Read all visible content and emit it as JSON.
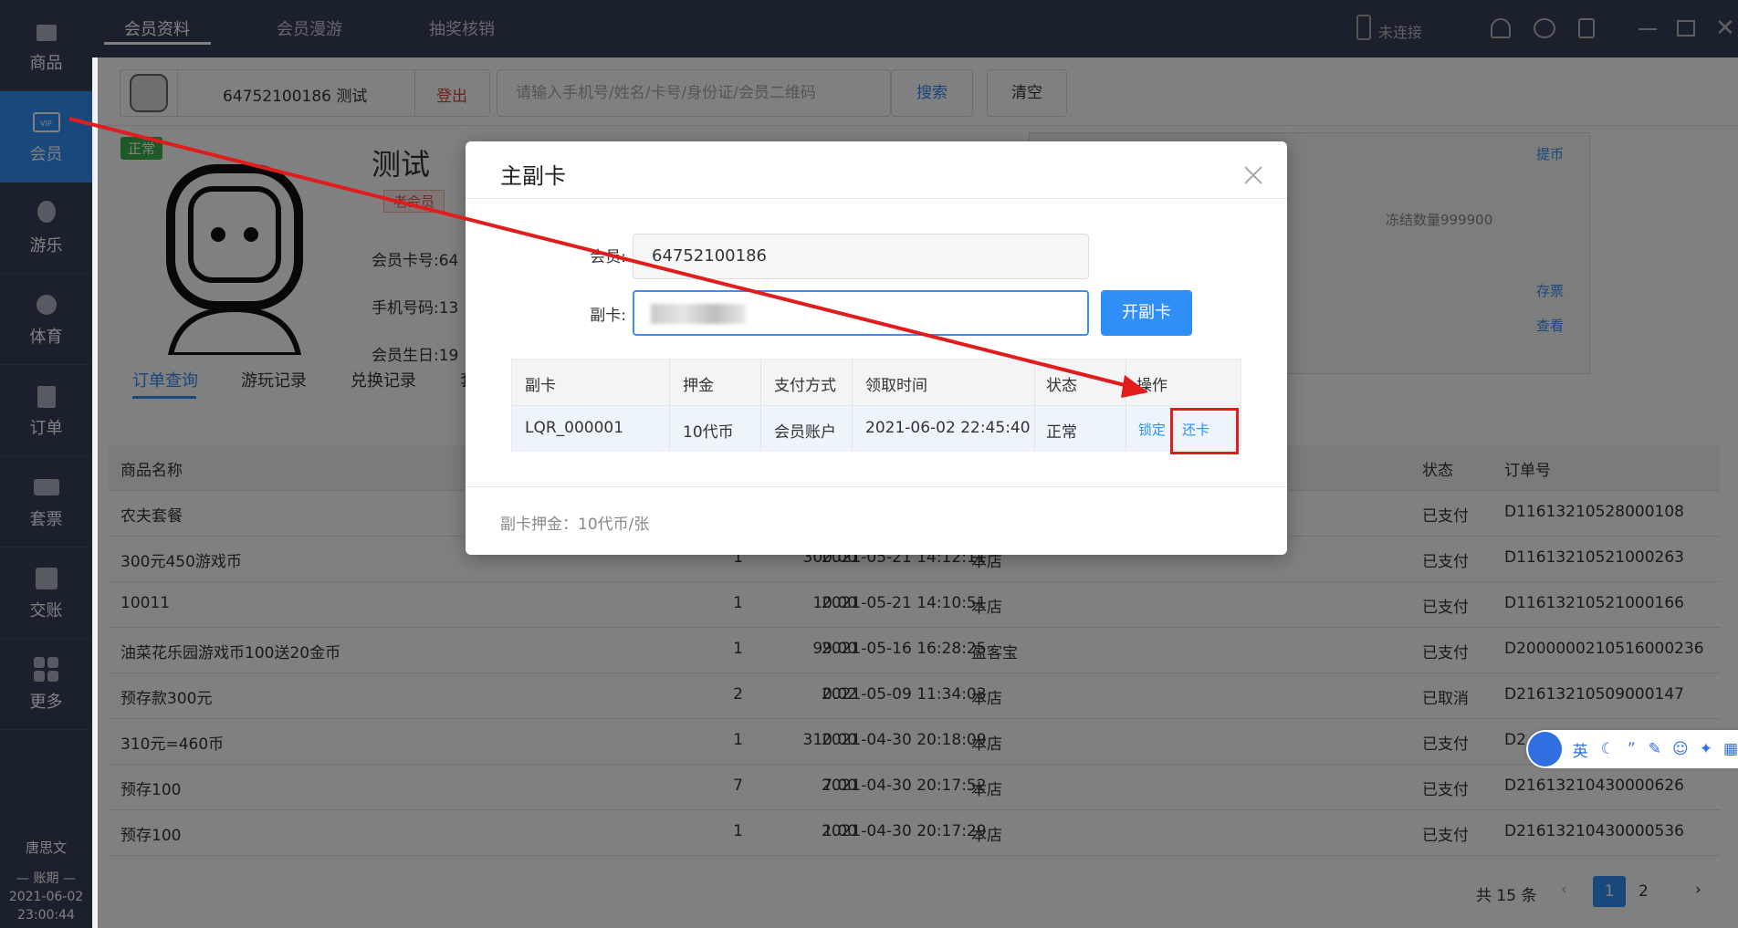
{
  "sidebar": {
    "items": [
      {
        "label": "商品",
        "icon": "shopping-bag-icon"
      },
      {
        "label": "会员",
        "icon": "vip-card-icon"
      },
      {
        "label": "游乐",
        "icon": "balloon-icon"
      },
      {
        "label": "体育",
        "icon": "ball-icon"
      },
      {
        "label": "订单",
        "icon": "clipboard-icon"
      },
      {
        "label": "套票",
        "icon": "ticket-icon"
      },
      {
        "label": "交账",
        "icon": "cash-icon"
      },
      {
        "label": "更多",
        "icon": "grid-icon"
      }
    ],
    "user": "唐思文",
    "period_label": "账期",
    "date": "2021-06-02",
    "time": "23:00:44"
  },
  "topbar": {
    "tabs": [
      "会员资料",
      "会员漫游",
      "抽奖核销"
    ],
    "connection_status": "未连接"
  },
  "search": {
    "member_id": "64752100186",
    "member_name": "测试",
    "logout_label": "登出",
    "placeholder": "请输入手机号/姓名/卡号/身份证/会员二维码",
    "search_label": "搜索",
    "clear_label": "清空"
  },
  "profile": {
    "status_badge": "正常",
    "name": "测试",
    "tag": "老会员",
    "card_no_label": "会员卡号:",
    "card_no_partial": "64",
    "phone_label": "手机号码:",
    "phone_partial": "13",
    "birthday_label": "会员生日:",
    "birthday_partial": "19"
  },
  "right_panel": {
    "withdraw": "提币",
    "frozen": "冻结数量999900",
    "deposit_ticket": "存票",
    "view": "查看"
  },
  "subtabs": [
    "订单查询",
    "游玩记录",
    "兑换记录",
    "套"
  ],
  "orders": {
    "headers": {
      "name": "商品名称",
      "status": "状态",
      "order_no": "订单号"
    },
    "rows": [
      {
        "name": "农夫套餐",
        "qty": "",
        "amount": "",
        "time": "",
        "store": "",
        "status": "已支付",
        "order_no": "D11613210528000108"
      },
      {
        "name": "300元450游戏币",
        "qty": "1",
        "amount": "300.00",
        "time": "2021-05-21 14:12:11",
        "store": "本店",
        "status": "已支付",
        "order_no": "D11613210521000263"
      },
      {
        "name": "10011",
        "qty": "1",
        "amount": "10.00",
        "time": "2021-05-21 14:10:51",
        "store": "本店",
        "status": "已支付",
        "order_no": "D11613210521000166"
      },
      {
        "name": "油菜花乐园游戏币100送20金币",
        "qty": "1",
        "amount": "99.00",
        "time": "2021-05-16 16:28:25",
        "store": "盈客宝",
        "status": "已支付",
        "order_no": "D2000000210516000236"
      },
      {
        "name": "预存款300元",
        "qty": "2",
        "amount": "0.02",
        "time": "2021-05-09 11:34:03",
        "store": "本店",
        "status": "已取消",
        "order_no": "D21613210509000147"
      },
      {
        "name": "310元=460币",
        "qty": "1",
        "amount": "310.00",
        "time": "2021-04-30 20:18:09",
        "store": "本店",
        "status": "已支付",
        "order_no": "D2"
      },
      {
        "name": "预存100",
        "qty": "7",
        "amount": "7.00",
        "time": "2021-04-30 20:17:52",
        "store": "本店",
        "status": "已支付",
        "order_no": "D21613210430000626"
      },
      {
        "name": "预存100",
        "qty": "1",
        "amount": "1.00",
        "time": "2021-04-30 20:17:29",
        "store": "本店",
        "status": "已支付",
        "order_no": "D21613210430000536"
      }
    ]
  },
  "pagination": {
    "total": "共 15 条",
    "page1": "1",
    "page2": "2"
  },
  "modal": {
    "title": "主副卡",
    "member_label": "会员:",
    "member_value": "64752100186",
    "subcard_label": "副卡:",
    "open_button": "开副卡",
    "table_headers": [
      "副卡",
      "押金",
      "支付方式",
      "领取时间",
      "状态",
      "操作"
    ],
    "row": {
      "card": "LQR_000001",
      "deposit": "10代币",
      "payment": "会员账户",
      "time": "2021-06-02 22:45:40",
      "status": "正常",
      "lock": "锁定",
      "return": "还卡"
    },
    "footer": "副卡押金：10代币/张"
  },
  "ime": {
    "lang": "英"
  },
  "colors": {
    "accent": "#2f8ff7",
    "sidebar": "#36405a",
    "annotation": "#e01c1c"
  }
}
